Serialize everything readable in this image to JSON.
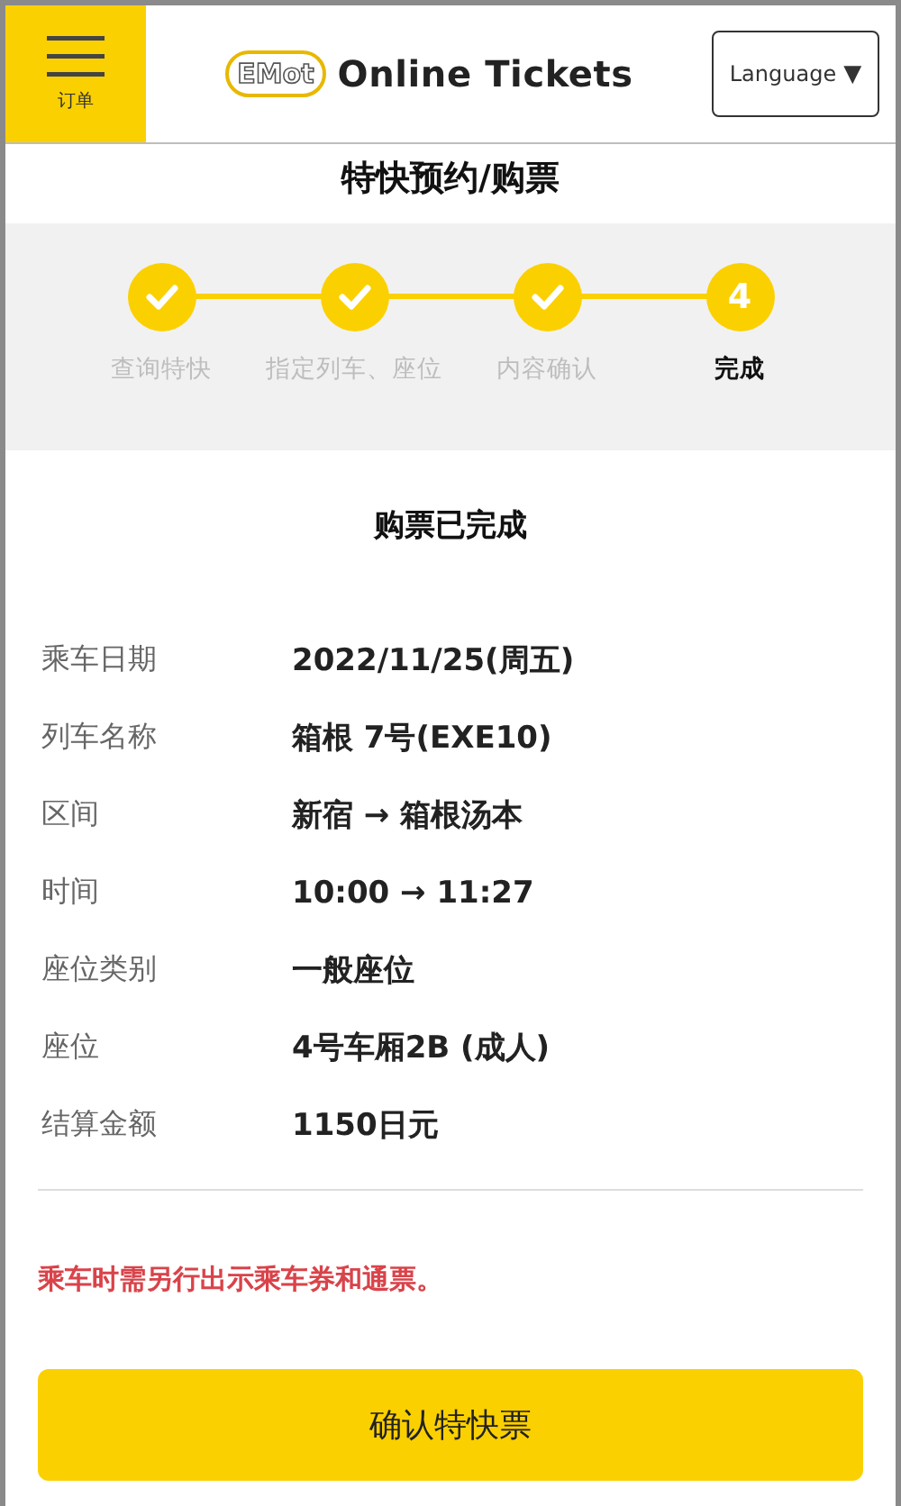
{
  "header": {
    "menu_label": "订单",
    "logo_mark": "EMot",
    "logo_text": "Online Tickets",
    "language_button": "Language",
    "language_caret": "▼"
  },
  "page_title": "特快预约/购票",
  "steps": [
    {
      "label": "查询特快",
      "kind": "done",
      "selected": false
    },
    {
      "label": "指定列车、座位",
      "kind": "done",
      "selected": false
    },
    {
      "label": "内容确认",
      "kind": "done",
      "selected": false
    },
    {
      "label": "完成",
      "kind": "current",
      "number": "4",
      "selected": true
    }
  ],
  "section_title": "购票已完成",
  "details": [
    {
      "label": "乘车日期",
      "value": "2022/11/25(周五)"
    },
    {
      "label": "列车名称",
      "value": "箱根 7号(EXE10)"
    },
    {
      "label": "区间",
      "value": "新宿 → 箱根汤本"
    },
    {
      "label": "时间",
      "value": "10:00 → 11:27"
    },
    {
      "label": "座位类别",
      "value": "一般座位"
    },
    {
      "label": "座位",
      "value": "4号车厢2B (成人)"
    },
    {
      "label": "结算金额",
      "value": "1150日元"
    }
  ],
  "notice": "乘车时需另行出示乘车券和通票。",
  "confirm_button": "确认特快票"
}
